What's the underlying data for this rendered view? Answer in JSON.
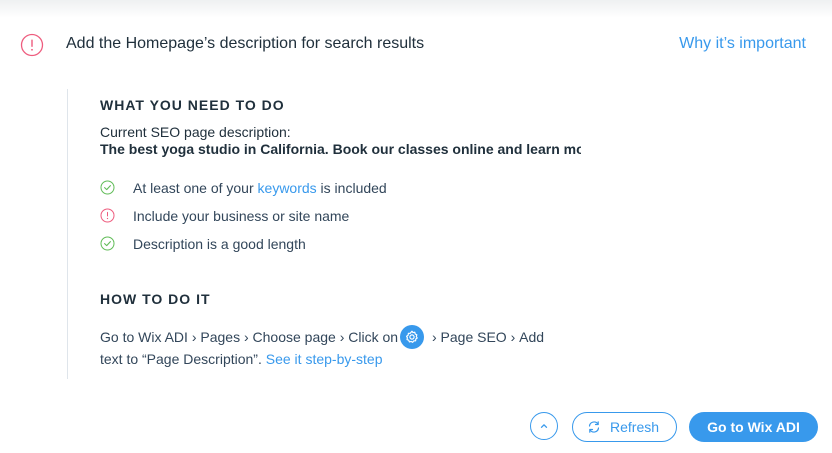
{
  "header": {
    "icon": "exclamation-circle-icon",
    "title": "Add the Homepage’s description for search results",
    "why_link": "Why it’s important"
  },
  "what_section": {
    "title": "WHAT YOU NEED TO DO",
    "description_label": "Current SEO page description:",
    "description_value": "The best yoga studio in California. Book our classes online and learn more about our teachers"
  },
  "checklist": [
    {
      "status": "pass",
      "icon": "check-circle-icon",
      "text_before": "At least one of your ",
      "link": "keywords",
      "text_after": " is included"
    },
    {
      "status": "warn",
      "icon": "exclamation-circle-icon",
      "text": "Include your business or site name"
    },
    {
      "status": "pass",
      "icon": "check-circle-icon",
      "text": "Description is a good length"
    }
  ],
  "how_section": {
    "title": "HOW TO DO IT",
    "steps": {
      "part1": "Go to Wix ADI",
      "part2": "Pages",
      "part3": "Choose page",
      "part4": "Click on",
      "gear_icon": "gear-icon",
      "part5": "Page SEO",
      "part6": "Add",
      "line2_text": "text to “Page Description”.",
      "step_link": "See it step-by-step",
      "separator": "›"
    }
  },
  "footer": {
    "collapse_icon": "chevron-up-icon",
    "refresh_icon": "refresh-icon",
    "refresh_label": "Refresh",
    "primary_label": "Go to Wix ADI"
  },
  "colors": {
    "accent": "#3899ec",
    "success": "#60bc57",
    "warning": "#ee5c7e",
    "text": "#20303c"
  }
}
